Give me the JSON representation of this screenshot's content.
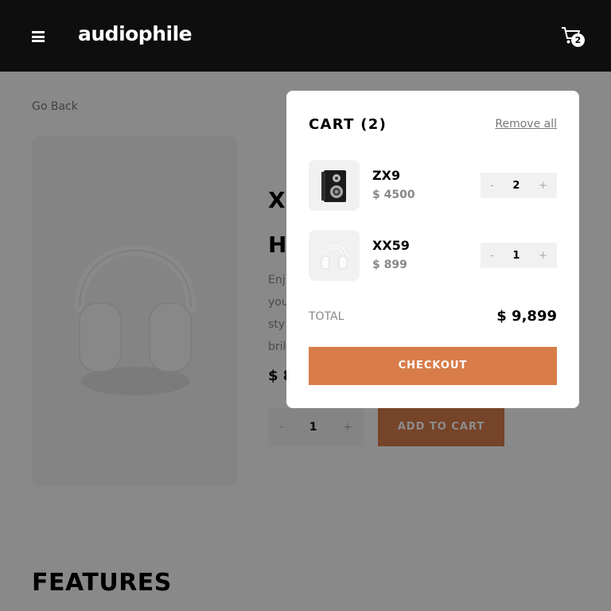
{
  "header": {
    "logo": "audiophile",
    "cart_count": "2",
    "menu_icon": "hamburger-icon",
    "cart_icon": "cart-icon"
  },
  "page": {
    "go_back": "Go Back",
    "product_title_line1": "XX",
    "product_title_line2": "H",
    "product_desc_lines": [
      "Enj",
      "you",
      "sty",
      "bril"
    ],
    "product_price": "$ 8",
    "quantity": "1",
    "minus": "-",
    "plus": "+",
    "add_to_cart": "ADD TO CART",
    "features_heading": "FEATURES"
  },
  "cart": {
    "title": "CART (2)",
    "remove_all": "Remove all",
    "items": [
      {
        "name": "ZX9",
        "price": "$ 4500",
        "qty": "2",
        "thumb": "speaker-image"
      },
      {
        "name": "XX59",
        "price": "$ 899",
        "qty": "1",
        "thumb": "headphones-image"
      }
    ],
    "minus": "-",
    "plus": "+",
    "total_label": "TOTAL",
    "total_value": "$ 9,899",
    "checkout": "CHECKOUT"
  },
  "colors": {
    "accent": "#d87d4a",
    "header_bg": "#0e0e0e",
    "overlay": "rgba(0,0,0,0.45)"
  }
}
